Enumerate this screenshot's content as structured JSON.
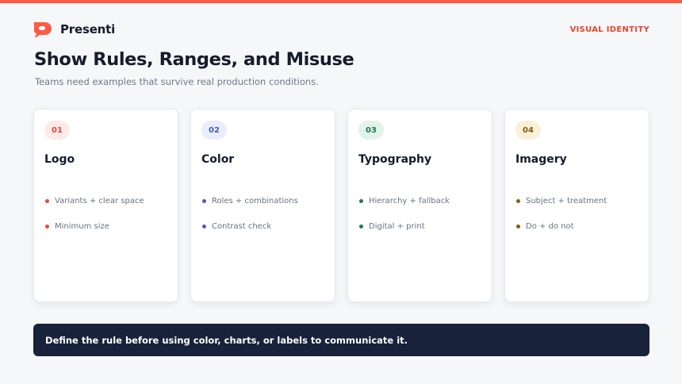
{
  "brand": {
    "name": "Presenti",
    "accent": "#ff5a45"
  },
  "eyebrow": "VISUAL IDENTITY",
  "title": "Show Rules, Ranges, and Misuse",
  "subtitle": "Teams need examples that survive real production conditions.",
  "cards": [
    {
      "number": "01",
      "title": "Logo",
      "color": "#e8493a",
      "badge_bg": "#fdebe8",
      "bullets": [
        "Variants + clear space",
        "Minimum size"
      ]
    },
    {
      "number": "02",
      "title": "Color",
      "color": "#4a5bc4",
      "badge_bg": "#eaedfb",
      "bullets": [
        "Roles + combinations",
        "Contrast check"
      ]
    },
    {
      "number": "03",
      "title": "Typography",
      "color": "#1d7a55",
      "badge_bg": "#e1f3ea",
      "bullets": [
        "Hierarchy + fallback",
        "Digital + print"
      ]
    },
    {
      "number": "04",
      "title": "Imagery",
      "color": "#8a5a10",
      "badge_bg": "#fbf0d9",
      "bullets": [
        "Subject + treatment",
        "Do + do not"
      ]
    }
  ],
  "callout": "Define the rule before using color, charts, or labels to communicate it."
}
